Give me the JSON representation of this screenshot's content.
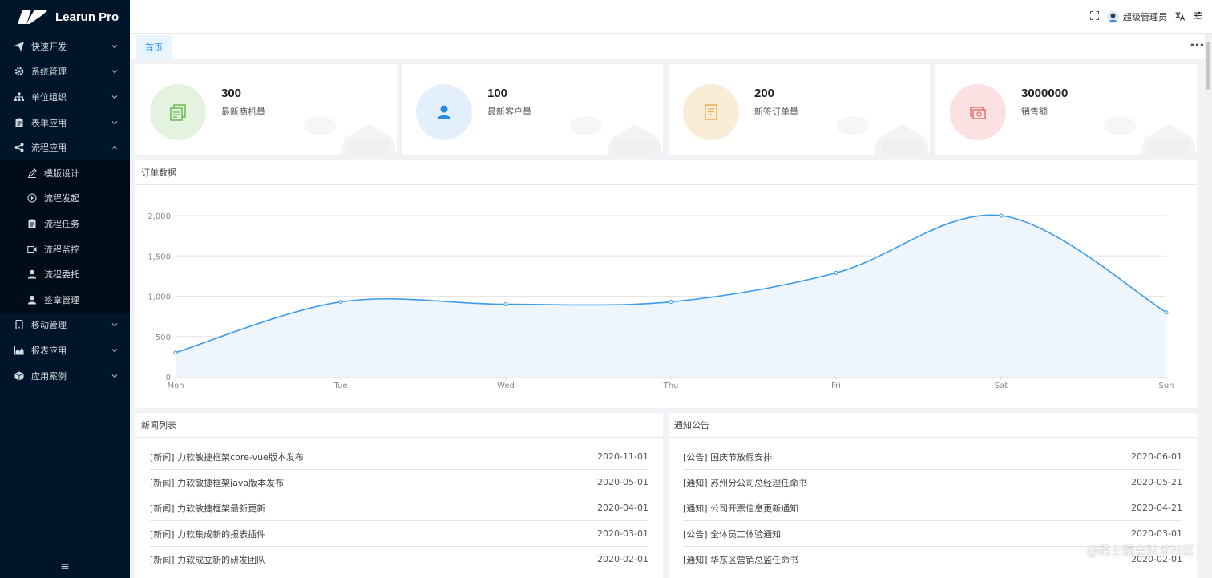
{
  "app": {
    "title": "Learun Pro"
  },
  "sidebar": {
    "items": [
      {
        "label": "快速开发",
        "icon": "paper-plane-icon"
      },
      {
        "label": "系统管理",
        "icon": "gear-icon"
      },
      {
        "label": "单位组织",
        "icon": "sitemap-icon"
      },
      {
        "label": "表单应用",
        "icon": "clipboard-icon"
      },
      {
        "label": "流程应用",
        "icon": "share-icon",
        "expanded": true
      }
    ],
    "subitems": [
      {
        "label": "模版设计",
        "icon": "pencil-icon"
      },
      {
        "label": "流程发起",
        "icon": "play-circle-icon"
      },
      {
        "label": "流程任务",
        "icon": "clipboard-icon"
      },
      {
        "label": "流程监控",
        "icon": "video-icon"
      },
      {
        "label": "流程委托",
        "icon": "user-icon"
      },
      {
        "label": "签章管理",
        "icon": "user-stamp-icon"
      }
    ],
    "items_after": [
      {
        "label": "移动管理",
        "icon": "tablet-icon"
      },
      {
        "label": "报表应用",
        "icon": "area-chart-icon"
      },
      {
        "label": "应用案例",
        "icon": "cube-icon"
      }
    ],
    "collapse_glyph": "≡"
  },
  "header": {
    "user_name": "超级管理员"
  },
  "tabs": [
    {
      "label": "首页",
      "active": true
    }
  ],
  "tabs_more": "•••",
  "stats": [
    {
      "value": "300",
      "label": "最新商机量",
      "color": "#63b74a",
      "bg": "#e3f3df",
      "icon": "copy-icon"
    },
    {
      "value": "100",
      "label": "最新客户量",
      "color": "#2b8ae6",
      "bg": "#e3f0fc",
      "icon": "user-icon"
    },
    {
      "value": "200",
      "label": "新签订单量",
      "color": "#e8a948",
      "bg": "#fbecd7",
      "icon": "document-icon"
    },
    {
      "value": "3000000",
      "label": "销售额",
      "color": "#e66a6a",
      "bg": "#fbe1e1",
      "icon": "money-icon"
    }
  ],
  "chart_panel": {
    "title": "订单数据"
  },
  "chart_data": {
    "type": "area",
    "categories": [
      "Mon",
      "Tue",
      "Wed",
      "Thu",
      "Fri",
      "Sat",
      "Sun"
    ],
    "values": [
      300,
      930,
      900,
      930,
      1290,
      2000,
      800
    ],
    "ylim": [
      0,
      2000
    ],
    "yticks": [
      "0",
      "500",
      "1,000",
      "1,500",
      "2,000"
    ],
    "ytick_values": [
      0,
      500,
      1000,
      1500,
      2000
    ],
    "line_color": "#3d9be9",
    "fill_color": "#eef5fd",
    "grid": true,
    "smooth": true
  },
  "news": {
    "title": "新闻列表",
    "rows": [
      {
        "text": "[新闻] 力软敏捷框架core-vue版本发布",
        "date": "2020-11-01"
      },
      {
        "text": "[新闻] 力软敏捷框架java版本发布",
        "date": "2020-05-01"
      },
      {
        "text": "[新闻] 力软敏捷框架最新更新",
        "date": "2020-04-01"
      },
      {
        "text": "[新闻] 力软集成新的报表插件",
        "date": "2020-03-01"
      },
      {
        "text": "[新闻] 力软成立新的研发团队",
        "date": "2020-02-01"
      }
    ]
  },
  "notices": {
    "title": "通知公告",
    "rows": [
      {
        "text": "[公告] 国庆节放假安排",
        "date": "2020-06-01"
      },
      {
        "text": "[通知] 苏州分公司总经理任命书",
        "date": "2020-05-21"
      },
      {
        "text": "[通知] 公司开票信息更新通知",
        "date": "2020-04-21"
      },
      {
        "text": "[公告] 全体员工体验通知",
        "date": "2020-03-01"
      },
      {
        "text": "[通知] 华东区营销总监任命书",
        "date": "2020-02-01"
      }
    ]
  },
  "watermark": "@稀土掘金技术社区"
}
